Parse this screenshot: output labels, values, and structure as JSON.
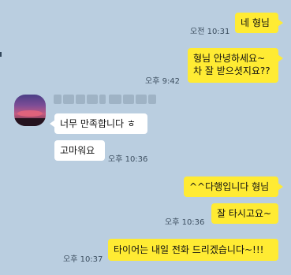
{
  "chat": {
    "messages": [
      {
        "sender": "me",
        "lines": [
          "네 형님"
        ],
        "time": "오전 10:31"
      },
      {
        "sender": "me",
        "lines": [
          "형님 안녕하세요~",
          "차 잘 받으셧지요??"
        ],
        "time": "오후 9:42"
      },
      {
        "sender": "other",
        "lines": [
          "너무 만족합니다 ㅎ"
        ],
        "time": ""
      },
      {
        "sender": "other",
        "lines": [
          "고마워요"
        ],
        "time": "오후 10:36"
      },
      {
        "sender": "me",
        "lines": [
          "^^다행입니다 형님"
        ],
        "time": ""
      },
      {
        "sender": "me",
        "lines": [
          "잘 타시고요~"
        ],
        "time": "오후 10:36"
      },
      {
        "sender": "me",
        "lines": [
          "타이어는 내일 전화 드리겠습니다~!!!"
        ],
        "time": "오후 10:37"
      }
    ]
  },
  "colors": {
    "background": "#bacee0",
    "my_bubble": "#ffeb33",
    "their_bubble": "#ffffff",
    "timestamp": "#3d4f60"
  }
}
